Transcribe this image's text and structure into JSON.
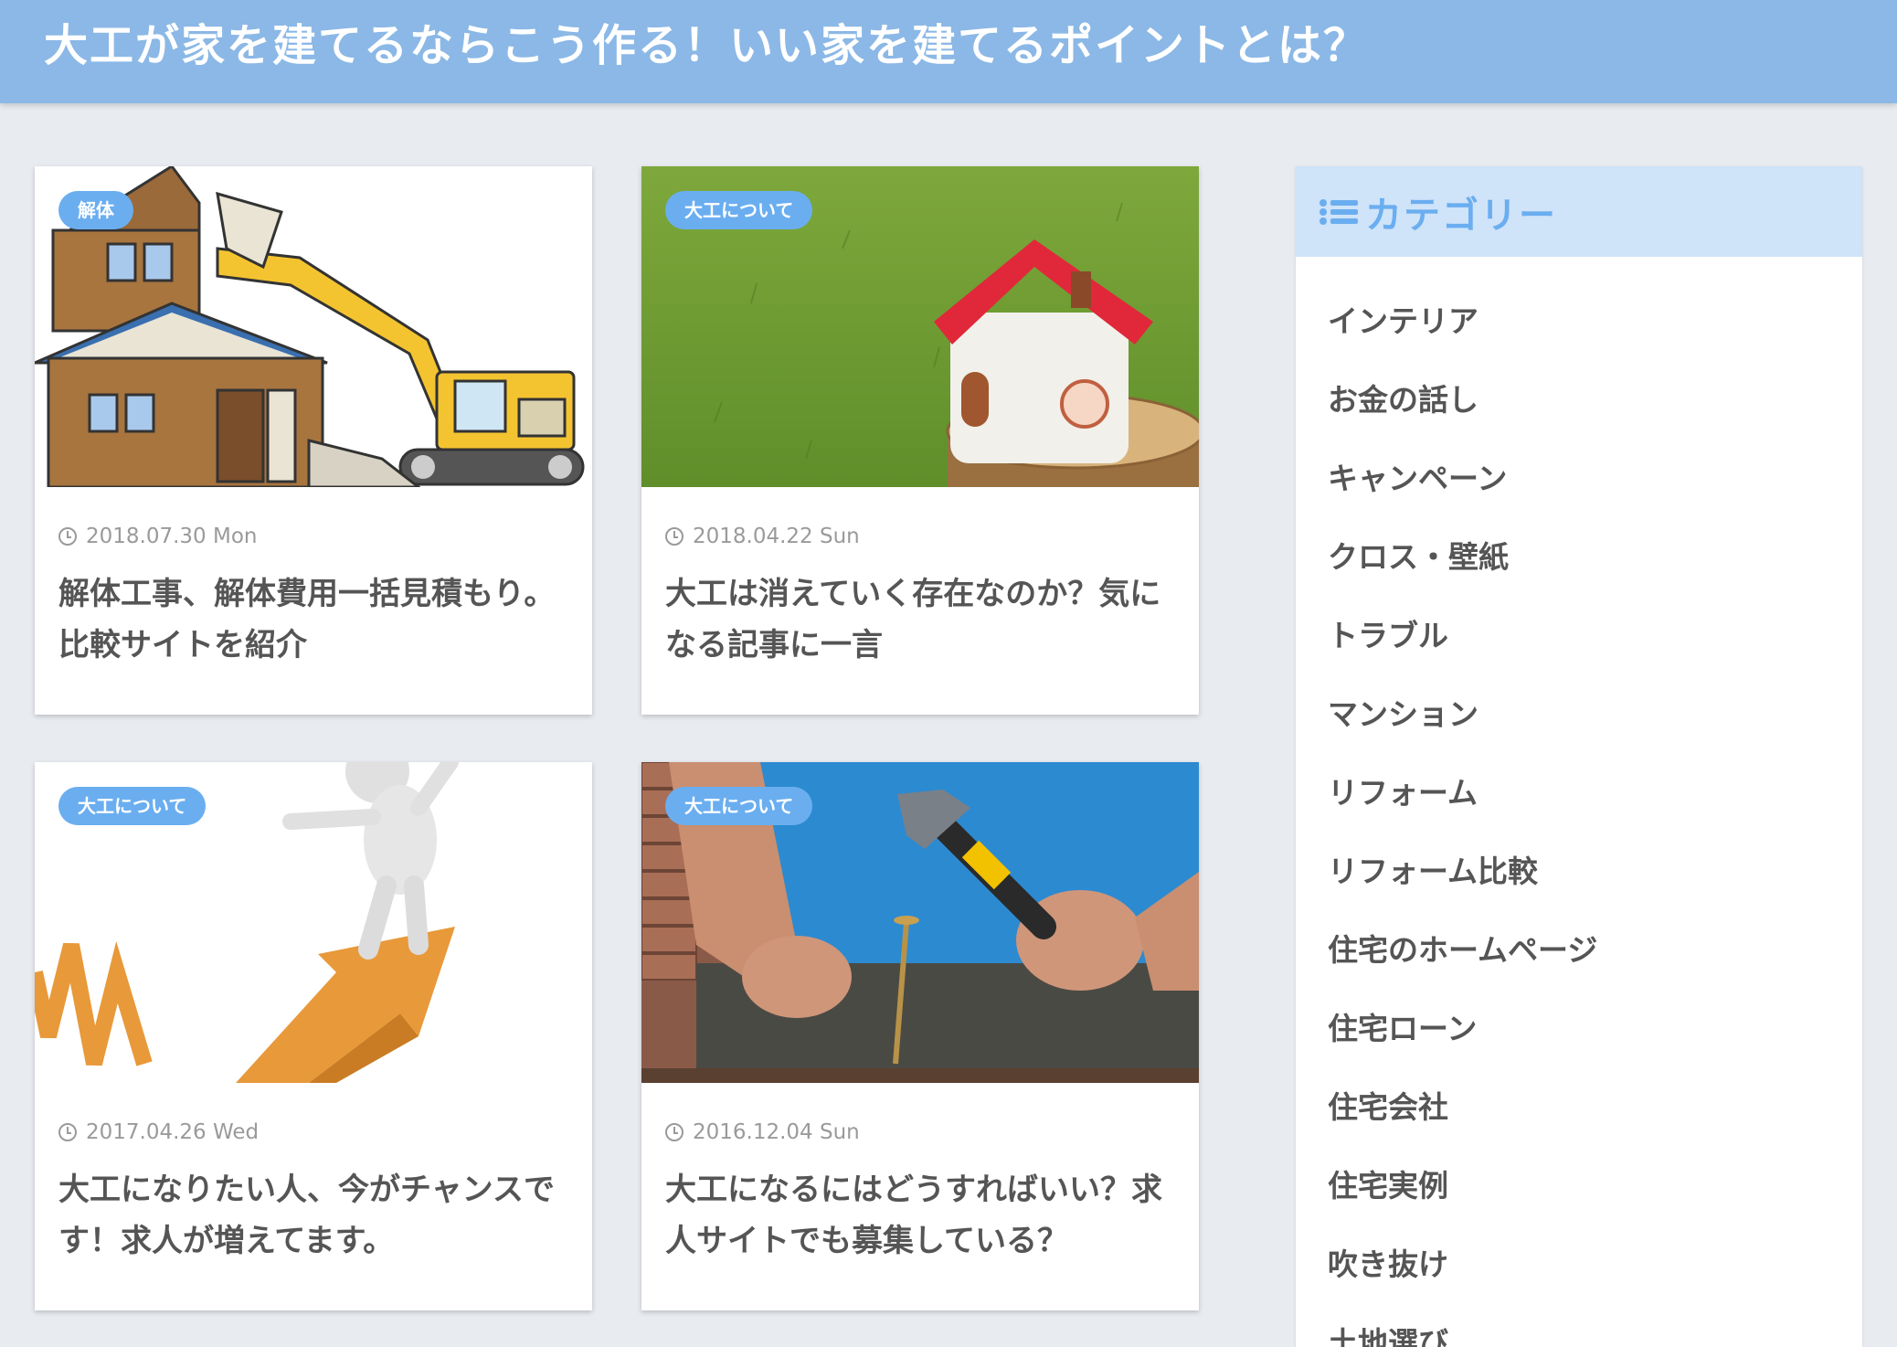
{
  "site": {
    "title": "大工が家を建てるならこう作る！いい家を建てるポイントとは？"
  },
  "posts": [
    {
      "category": "解体",
      "date": "2018.07.30 Mon",
      "title": "解体工事、解体費用一括見積もり。比較サイトを紹介"
    },
    {
      "category": "大工について",
      "date": "2018.04.22 Sun",
      "title": "大工は消えていく存在なのか？気になる記事に一言"
    },
    {
      "category": "大工について",
      "date": "2017.04.26 Wed",
      "title": "大工になりたい人、今がチャンスです！求人が増えてます。"
    },
    {
      "category": "大工について",
      "date": "2016.12.04 Sun",
      "title": "大工になるにはどうすればいい？求人サイトでも募集している？"
    }
  ],
  "sidebar": {
    "heading": "カテゴリー",
    "categories": [
      "インテリア",
      "お金の話し",
      "キャンペーン",
      "クロス・壁紙",
      "トラブル",
      "マンション",
      "リフォーム",
      "リフォーム比較",
      "住宅のホームページ",
      "住宅ローン",
      "住宅会社",
      "住宅実例",
      "吹き抜け",
      "土地選び"
    ]
  },
  "colors": {
    "header": "#8bb8e6",
    "accent": "#6aaef0",
    "sidebar_head": "#cfe3f9",
    "background": "#e8ebf0"
  }
}
